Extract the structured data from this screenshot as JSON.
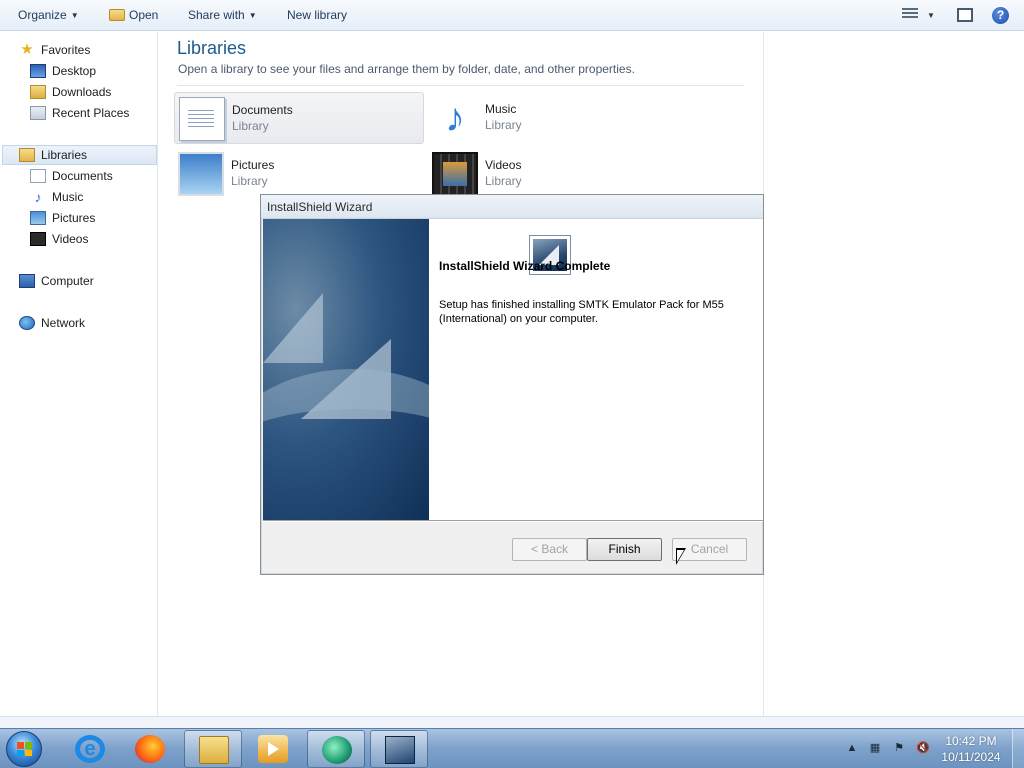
{
  "toolbar": {
    "organize": "Organize",
    "open": "Open",
    "share_with": "Share with",
    "new_library": "New library",
    "help_glyph": "?"
  },
  "nav": {
    "favorites": "Favorites",
    "desktop": "Desktop",
    "downloads": "Downloads",
    "recent_places": "Recent Places",
    "libraries": "Libraries",
    "documents": "Documents",
    "music": "Music",
    "pictures": "Pictures",
    "videos": "Videos",
    "computer": "Computer",
    "network": "Network"
  },
  "main": {
    "title": "Libraries",
    "subtitle": "Open a library to see your files and arrange them by folder, date, and other properties.",
    "tiles": [
      {
        "name": "Documents",
        "type": "Library"
      },
      {
        "name": "Music",
        "type": "Library"
      },
      {
        "name": "Pictures",
        "type": "Library"
      },
      {
        "name": "Videos",
        "type": "Library"
      }
    ]
  },
  "dialog": {
    "title": "InstallShield Wizard",
    "heading": "InstallShield Wizard Complete",
    "body": "Setup has finished installing SMTK Emulator Pack for M55 (International) on your computer.",
    "back": "< Back",
    "finish": "Finish",
    "cancel": "Cancel"
  },
  "taskbar": {
    "time": "10:42 PM",
    "date": "10/11/2024"
  },
  "icons": {
    "favorites": "star-icon",
    "tray": [
      "show-hidden-icon",
      "network-icon",
      "flag-icon",
      "volume-muted-icon"
    ]
  }
}
